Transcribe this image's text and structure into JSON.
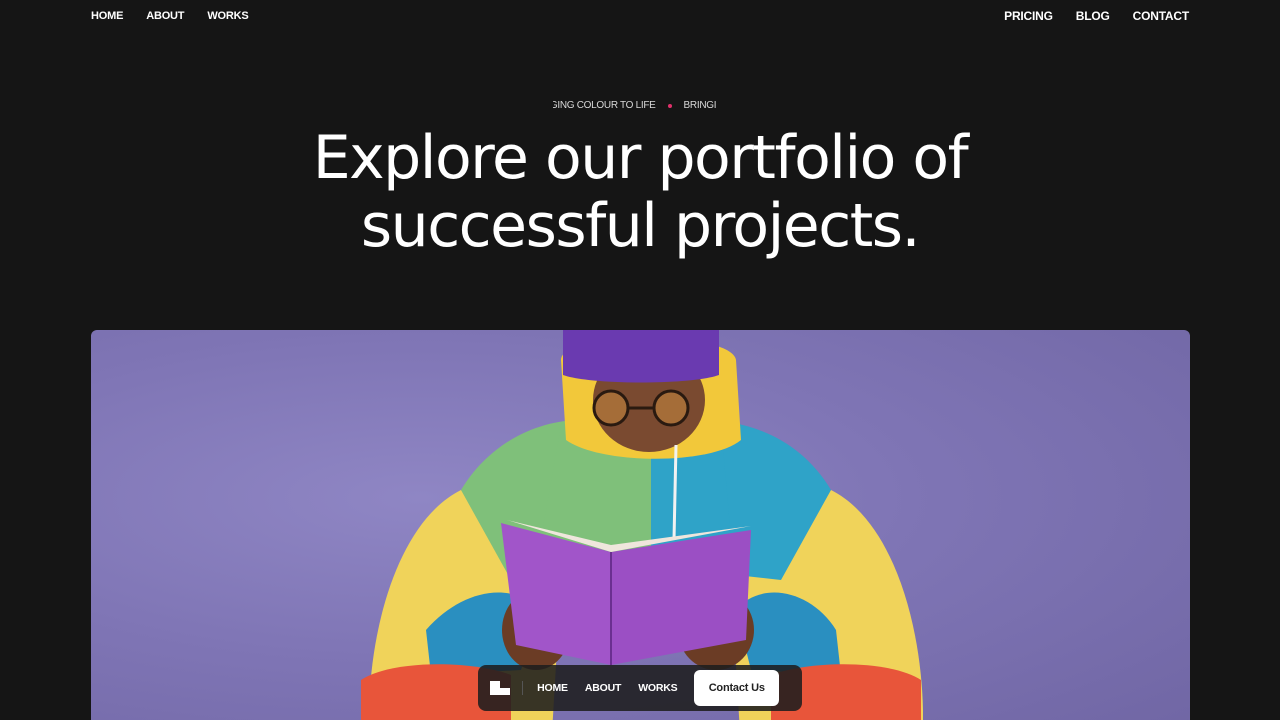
{
  "nav": {
    "left": [
      {
        "label": "HOME"
      },
      {
        "label": "ABOUT"
      },
      {
        "label": "WORKS"
      }
    ],
    "right": [
      {
        "label": "PRICING"
      },
      {
        "label": "BLOG"
      },
      {
        "label": "CONTACT"
      }
    ]
  },
  "ticker": {
    "text_a": "NGING COLOUR TO LIFE",
    "text_b": "BRINGI",
    "dot_color": "#e0306a"
  },
  "hero": {
    "title_line1": "Explore our portfolio of",
    "title_line2": "successful projects."
  },
  "image": {
    "subject": "person-reading-book-icon",
    "background_color": "#8178b8"
  },
  "float_nav": {
    "logo": "brand-logo-icon",
    "items": [
      {
        "label": "HOME"
      },
      {
        "label": "ABOUT"
      },
      {
        "label": "WORKS"
      }
    ],
    "cta_label": "Contact Us"
  },
  "colors": {
    "background": "#151515",
    "text": "#ffffff",
    "accent": "#e0306a"
  }
}
